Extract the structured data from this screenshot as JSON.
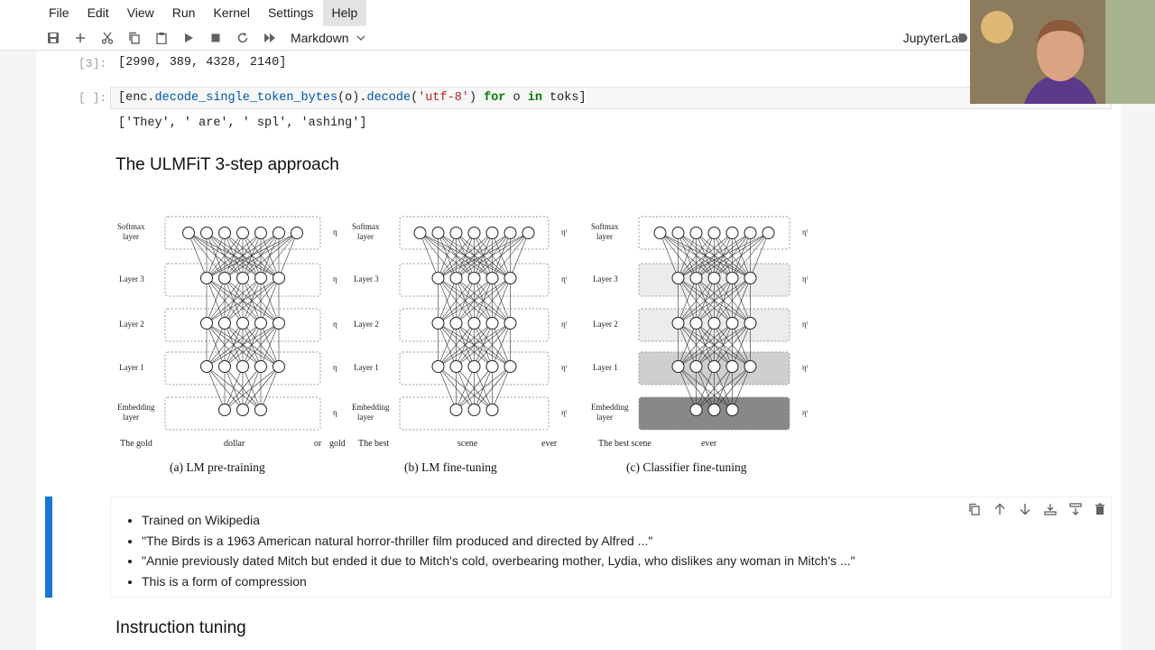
{
  "menu": [
    "File",
    "Edit",
    "View",
    "Run",
    "Kernel",
    "Settings",
    "Help"
  ],
  "toolbar": {
    "cell_type": "Markdown",
    "jupyterlab_label": "JupyterLab",
    "icons": [
      "save-icon",
      "add-icon",
      "cut-icon",
      "copy-icon",
      "paste-icon",
      "run-icon",
      "stop-icon",
      "restart-icon",
      "fast-forward-icon"
    ]
  },
  "cells": {
    "out1_prompt": "[3]:",
    "out1_text": "[2990, 389, 4328, 2140]",
    "in2_prompt": "[ ]:",
    "in2_code": {
      "part1": "[enc.",
      "part2": "decode_single_token_bytes",
      "part3": "(o).",
      "part4": "decode",
      "part5": "(",
      "part6": "'utf-8'",
      "part7": ") ",
      "part8": "for",
      "part9": " o ",
      "part10": "in",
      "part11": " toks]"
    },
    "out2_text": "['They', ' are', ' spl', 'ashing']",
    "heading1": "The ULMFiT 3-step approach",
    "heading2": "Instruction tuning",
    "bullets": [
      "Trained on Wikipedia",
      "\"The Birds is a 1963 American natural horror-thriller film produced and directed by Alfred ...\"",
      "\"Annie previously dated Mitch but ended it due to Mitch's cold, overbearing mother, Lydia, who dislikes any woman in Mitch's ...\"",
      "This is a form of compression"
    ]
  },
  "figure": {
    "captions": [
      "(a) LM pre-training",
      "(b) LM fine-tuning",
      "(c) Classifier fine-tuning"
    ],
    "layers_a": [
      "Softmax layer",
      "Layer 3",
      "Layer 2",
      "Layer 1",
      "Embedding layer"
    ],
    "words_a": [
      "The gold",
      "dollar",
      "or",
      "gold"
    ],
    "words_b": [
      "The best",
      "scene",
      "ever"
    ],
    "words_c": [
      "The best scene",
      "ever"
    ],
    "eta": "η",
    "eta_l": "ηˡ"
  },
  "colors": {
    "accent": "#1976d2"
  }
}
